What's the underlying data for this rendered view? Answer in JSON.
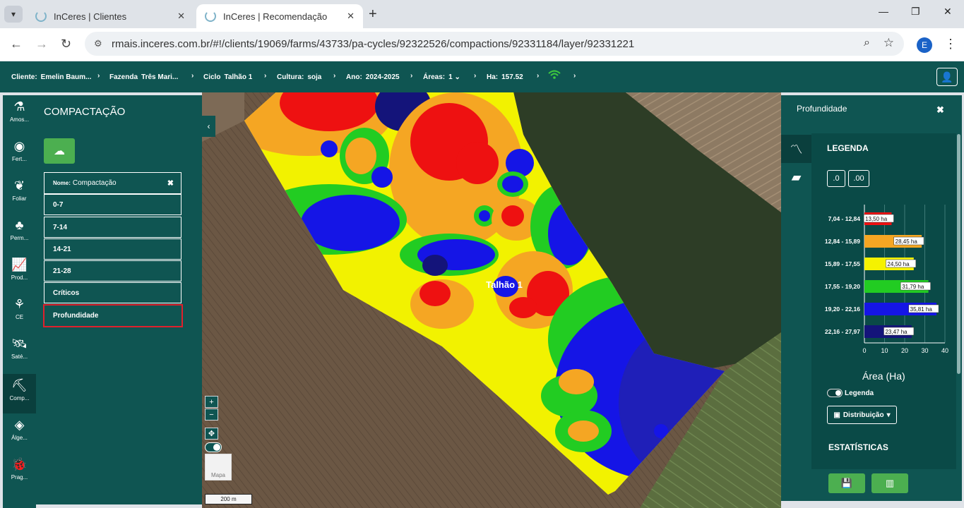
{
  "browser": {
    "tabs": [
      {
        "title": "InCeres | Clientes"
      },
      {
        "title": "InCeres | Recomendação"
      }
    ],
    "url": "rmais.inceres.com.br/#!/clients/19069/farms/43733/pa-cycles/92322526/compactions/92331184/layer/92331221",
    "profile_initial": "E"
  },
  "appbar": {
    "cliente_label": "Cliente:",
    "cliente_value": "Emelin Baum...",
    "fazenda_label": "Fazenda",
    "fazenda_value": "Três Mari...",
    "ciclo_label": "Ciclo",
    "ciclo_value": "Talhão 1",
    "cultura_label": "Cultura:",
    "cultura_value": "soja",
    "ano_label": "Ano:",
    "ano_value": "2024-2025",
    "areas_label": "Áreas:",
    "areas_value": "1",
    "ha_label": "Ha:",
    "ha_value": "157.52"
  },
  "rail": [
    {
      "label": "Amos..."
    },
    {
      "label": "Fert..."
    },
    {
      "label": "Foliar"
    },
    {
      "label": "Perm..."
    },
    {
      "label": "Prod..."
    },
    {
      "label": "CE"
    },
    {
      "label": "Saté..."
    },
    {
      "label": "Comp..."
    },
    {
      "label": "Álge..."
    },
    {
      "label": "Prag..."
    }
  ],
  "panel": {
    "title": "COMPACTAÇÃO",
    "name_label": "Nome:",
    "name_value": "Compactação",
    "layers": [
      "0-7",
      "7-14",
      "14-21",
      "21-28",
      "Críticos",
      "Profundidade"
    ],
    "selected_layer": "Profundidade"
  },
  "map": {
    "field_label": "Talhão 1",
    "zoom_in": "+",
    "zoom_out": "−",
    "minimap_label": "Mapa",
    "scale_label": "200 m"
  },
  "right_panel": {
    "title": "Profundidade",
    "legend_heading": "LEGENDA",
    "depth_btn_1": ".0",
    "depth_btn_2": ".00",
    "x_axis_label": "Área (Ha)",
    "legend_toggle_label": "Legenda",
    "distribution_label": "Distribuição",
    "stats_heading": "ESTATÍSTICAS"
  },
  "chart_data": {
    "type": "bar",
    "orientation": "horizontal",
    "categories": [
      "7,04 - 12,84",
      "12,84 - 15,89",
      "15,89 - 17,55",
      "17,55 - 19,20",
      "19,20 - 22,16",
      "22,16 - 27,97"
    ],
    "values": [
      13.5,
      28.45,
      24.5,
      31.79,
      35.81,
      23.47
    ],
    "value_labels": [
      "13,50 ha",
      "28,45 ha",
      "24,50 ha",
      "31,79 ha",
      "35,81 ha",
      "23,47 ha"
    ],
    "colors": [
      "#ee1111",
      "#f5a623",
      "#f5f200",
      "#22cc22",
      "#1515e6",
      "#14147a"
    ],
    "xlabel": "Área (Ha)",
    "xlim": [
      0,
      40
    ],
    "xticks": [
      0,
      10,
      20,
      30,
      40
    ]
  }
}
